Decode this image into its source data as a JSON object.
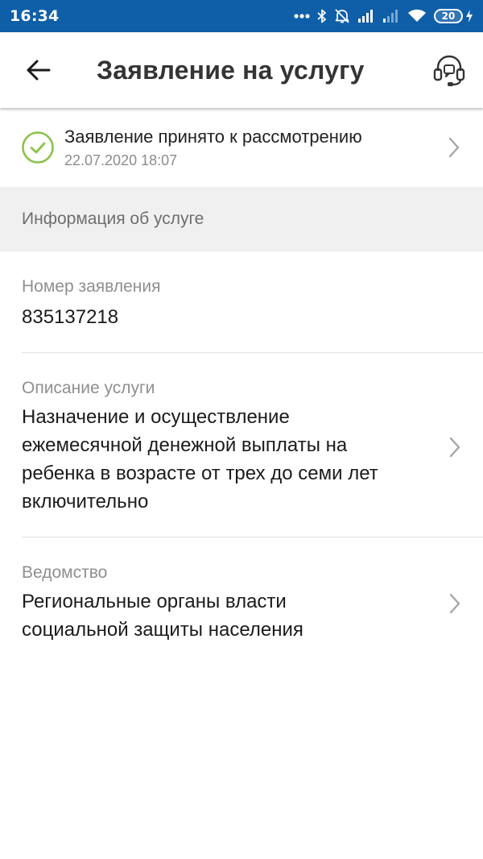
{
  "statusbar": {
    "time": "16:34",
    "battery": "20"
  },
  "appbar": {
    "title": "Заявление на услугу"
  },
  "status": {
    "title": "Заявление принято к рассмотрению",
    "date": "22.07.2020 18:07",
    "color": "#8bc34a"
  },
  "section": {
    "header": "Информация об услуге"
  },
  "fields": [
    {
      "label": "Номер заявления",
      "lines": [
        "835137218"
      ]
    },
    {
      "label": "Описание услуги",
      "lines": [
        "Назначение и осуществление",
        "ежемесячной денежной выплаты на",
        "ребенка в возрасте от трех до семи лет",
        "включительно"
      ]
    },
    {
      "label": "Ведомство",
      "lines": [
        "Региональные органы власти",
        "социальной защиты населения"
      ]
    }
  ],
  "colors": {
    "statusbar": "#0f5fa8",
    "section_bg": "#f0f0f0"
  }
}
